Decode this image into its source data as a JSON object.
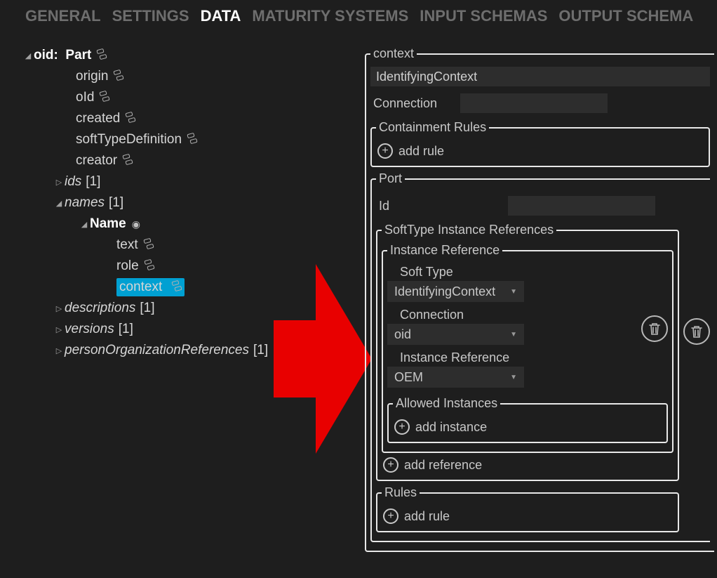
{
  "tabs": {
    "general": "GENERAL",
    "settings": "SETTINGS",
    "data": "DATA",
    "maturity": "MATURITY SYSTEMS",
    "input": "INPUT SCHEMAS",
    "output": "OUTPUT SCHEMA"
  },
  "tree": {
    "root": {
      "prefix": "oid:",
      "value": "Part"
    },
    "origin": "origin",
    "oid": "oId",
    "created": "created",
    "softtypedef": "softTypeDefinition",
    "creator": "creator",
    "ids": {
      "label": "ids",
      "count": "[1]"
    },
    "names": {
      "label": "names",
      "count": "[1]"
    },
    "name_node": "Name",
    "name_text": "text",
    "name_role": "role",
    "name_context": "context",
    "descriptions": {
      "label": "descriptions",
      "count": "[1]"
    },
    "versions": {
      "label": "versions",
      "count": "[1]"
    },
    "personorg": {
      "label": "personOrganizationReferences",
      "count": "[1]"
    }
  },
  "panel": {
    "context_legend": "context",
    "context_value": "IdentifyingContext",
    "connection_label": "Connection",
    "containment_legend": "Containment Rules",
    "add_rule": "add rule",
    "port_legend": "Port",
    "id_label": "Id",
    "softtype_refs_legend": "SoftType Instance References",
    "instance_ref_legend": "Instance Reference",
    "soft_type_label": "Soft Type",
    "soft_type_value": "IdentifyingContext",
    "connection2_label": "Connection",
    "connection2_value": "oid",
    "instance_ref_label": "Instance Reference",
    "instance_ref_value": "OEM",
    "allowed_legend": "Allowed Instances",
    "add_instance": "add instance",
    "add_reference": "add reference",
    "rules_legend": "Rules"
  }
}
